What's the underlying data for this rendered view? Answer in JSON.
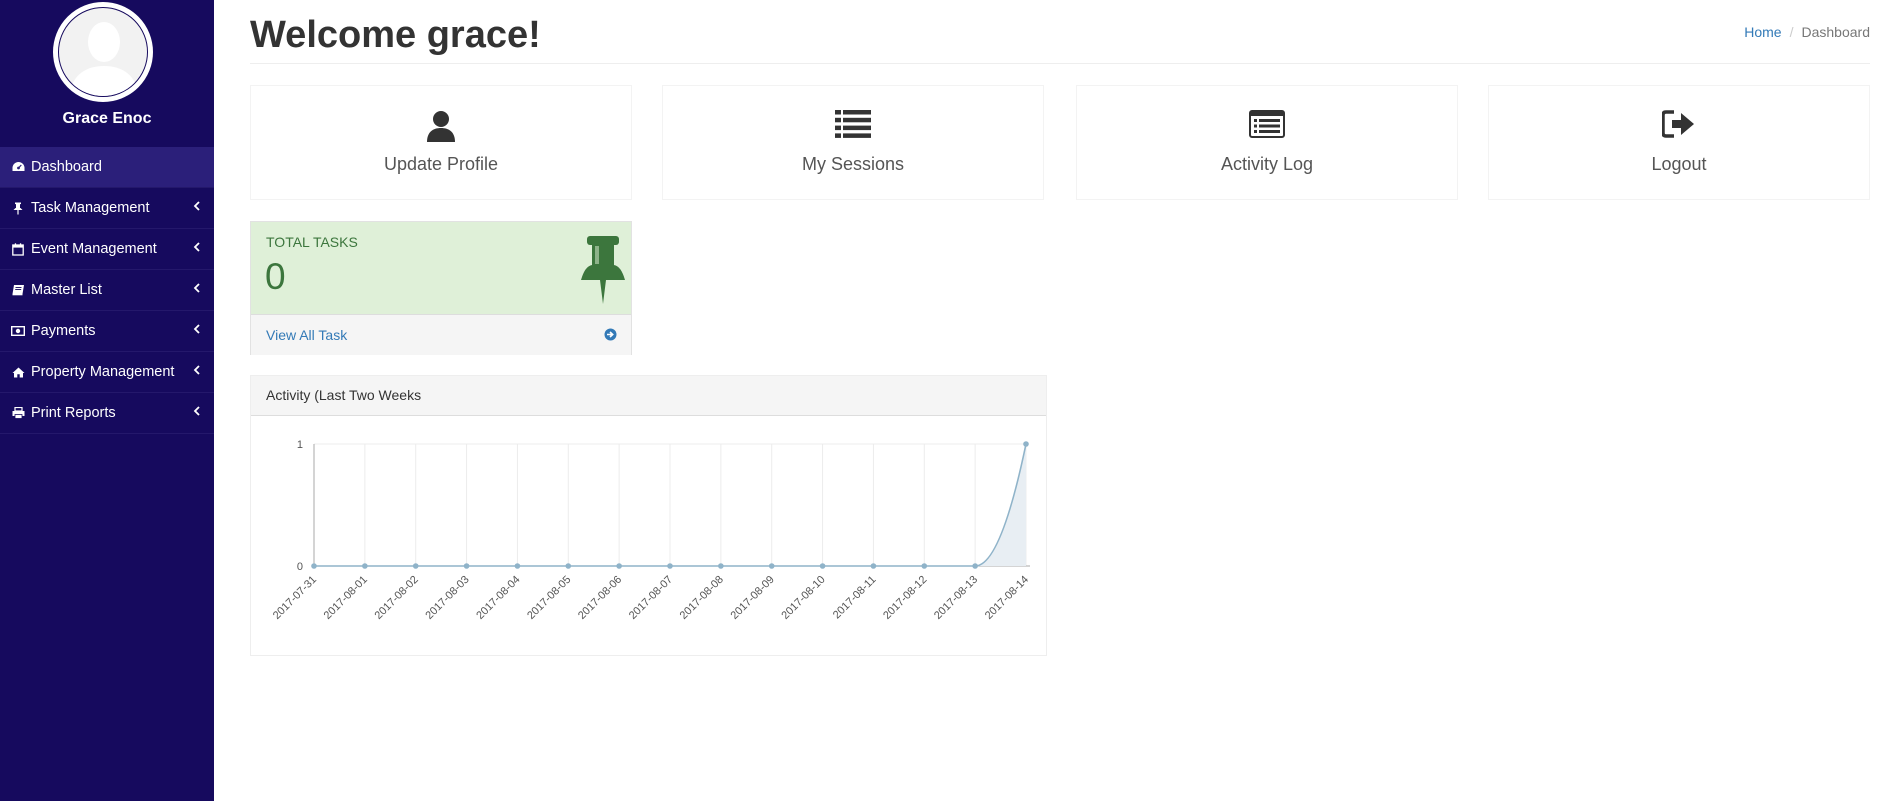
{
  "sidebar": {
    "user_name": "Grace Enoc",
    "items": [
      {
        "label": "Dashboard",
        "icon": "dashboard-icon",
        "active": true,
        "has_submenu": false
      },
      {
        "label": "Task Management",
        "icon": "thumbtack-icon",
        "has_submenu": true
      },
      {
        "label": "Event Management",
        "icon": "calendar-icon",
        "has_submenu": true
      },
      {
        "label": "Master List",
        "icon": "book-icon",
        "has_submenu": true
      },
      {
        "label": "Payments",
        "icon": "money-icon",
        "has_submenu": true
      },
      {
        "label": "Property Management",
        "icon": "home-icon",
        "has_submenu": true
      },
      {
        "label": "Print Reports",
        "icon": "print-icon",
        "has_submenu": true
      }
    ]
  },
  "header": {
    "title": "Welcome grace!",
    "breadcrumb": {
      "home": "Home",
      "current": "Dashboard"
    }
  },
  "tiles": [
    {
      "label": "Update Profile",
      "icon": "user-icon"
    },
    {
      "label": "My Sessions",
      "icon": "list-icon"
    },
    {
      "label": "Activity Log",
      "icon": "list-alt-icon"
    },
    {
      "label": "Logout",
      "icon": "sign-out-icon"
    }
  ],
  "stat": {
    "label": "TOTAL TASKS",
    "value": "0",
    "link": "View All Task",
    "icon": "thumbtack-icon"
  },
  "activity": {
    "title": "Activity (Last Two Weeks"
  },
  "colors": {
    "sidebar_bg": "#160a5e",
    "active_item_bg": "#2b1f7a",
    "stat_bg": "#dff0d8",
    "stat_text": "#3c763d",
    "link": "#337ab7",
    "chart_line": "#8fb3c9",
    "chart_fill": "#e8eef3"
  },
  "chart_data": {
    "type": "area",
    "x": [
      "2017-07-31",
      "2017-08-01",
      "2017-08-02",
      "2017-08-03",
      "2017-08-04",
      "2017-08-05",
      "2017-08-06",
      "2017-08-07",
      "2017-08-08",
      "2017-08-09",
      "2017-08-10",
      "2017-08-11",
      "2017-08-12",
      "2017-08-13",
      "2017-08-14"
    ],
    "series": [
      {
        "values": [
          0,
          0,
          0,
          0,
          0,
          0,
          0,
          0,
          0,
          0,
          0,
          0,
          0,
          0,
          1
        ]
      }
    ],
    "y_ticks": [
      "0",
      "1"
    ],
    "ylim": [
      0,
      1
    ],
    "grid": true
  }
}
